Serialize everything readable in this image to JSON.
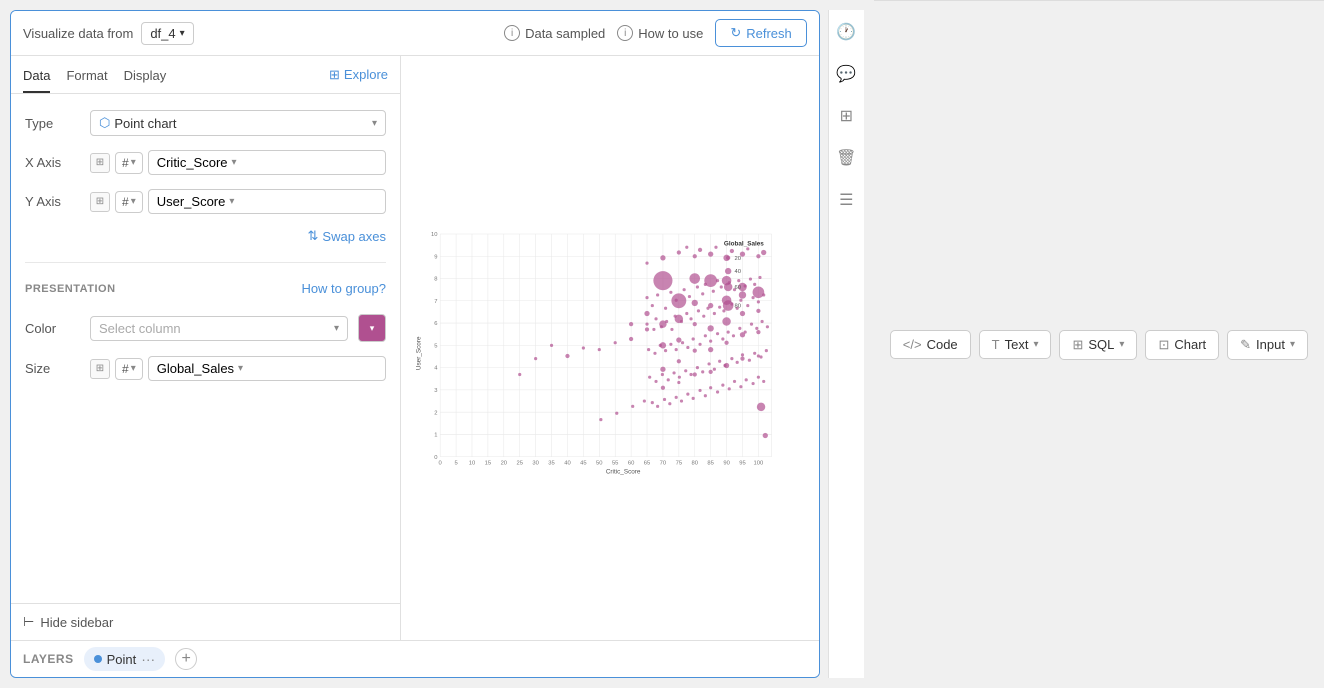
{
  "header": {
    "visualize_label": "Visualize data from",
    "df_value": "df_4",
    "data_sampled": "Data sampled",
    "how_to_use": "How to use",
    "refresh": "Refresh"
  },
  "sidebar": {
    "tabs": [
      "Data",
      "Format",
      "Display"
    ],
    "active_tab": "Data",
    "explore_label": "Explore",
    "type_label": "Type",
    "type_value": "Point chart",
    "x_axis_label": "X Axis",
    "x_axis_type": "#",
    "x_axis_value": "Critic_Score",
    "y_axis_label": "Y Axis",
    "y_axis_type": "#",
    "y_axis_value": "User_Score",
    "swap_axes": "Swap axes",
    "presentation_label": "PRESENTATION",
    "how_to_group": "How to group?",
    "color_label": "Color",
    "color_placeholder": "Select column",
    "size_label": "Size",
    "size_type": "#",
    "size_value": "Global_Sales",
    "hide_sidebar": "Hide sidebar"
  },
  "chart": {
    "x_axis_label": "Critic_Score",
    "y_axis_label": "User_Score",
    "legend_title": "Global_Sales",
    "legend": [
      {
        "label": "20",
        "size": 8
      },
      {
        "label": "40",
        "size": 12
      },
      {
        "label": "60",
        "size": 16
      },
      {
        "label": "80",
        "size": 20
      }
    ],
    "x_ticks": [
      "0",
      "5",
      "10",
      "15",
      "20",
      "25",
      "30",
      "35",
      "40",
      "45",
      "50",
      "55",
      "60",
      "65",
      "70",
      "75",
      "80",
      "85",
      "90",
      "95",
      "100"
    ],
    "y_ticks": [
      "0",
      "1",
      "2",
      "3",
      "4",
      "5",
      "6",
      "7",
      "8",
      "9",
      "10"
    ]
  },
  "layers": {
    "label": "LAYERS",
    "point_tab": "Point",
    "add_icon": "+"
  },
  "toolbar": {
    "code_label": "Code",
    "text_label": "Text",
    "sql_label": "SQL",
    "chart_label": "Chart",
    "input_label": "Input"
  }
}
